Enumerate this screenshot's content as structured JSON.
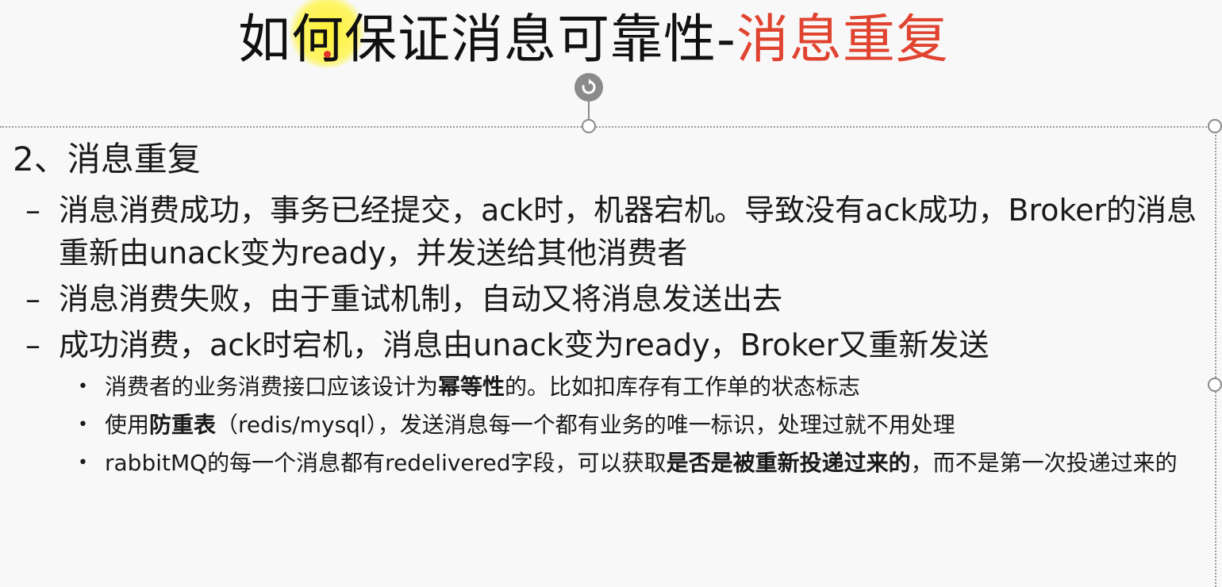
{
  "title": {
    "main": "如何保证消息可靠性-",
    "accent": "消息重复",
    "accent_color": "#e0432f"
  },
  "section_heading": "2、消息重复",
  "bullets": [
    {
      "marker": "–",
      "text": "消息消费成功，事务已经提交，ack时，机器宕机。导致没有ack成功，Broker的消息重新由unack变为ready，并发送给其他消费者"
    },
    {
      "marker": "–",
      "text": "消息消费失败，由于重试机制，自动又将消息发送出去"
    },
    {
      "marker": "–",
      "text": "成功消费，ack时宕机，消息由unack变为ready，Broker又重新发送"
    }
  ],
  "sub_bullets": [
    {
      "marker": "•",
      "pre": "消费者的业务消费接口应该设计为",
      "bold": "幂等性",
      "post": "的。比如扣库存有工作单的状态标志"
    },
    {
      "marker": "•",
      "pre": "使用",
      "bold": "防重表",
      "post": "（redis/mysql），发送消息每一个都有业务的唯一标识，处理过就不用处理"
    },
    {
      "marker": "•",
      "pre": "rabbitMQ的每一个消息都有redelivered字段，可以获取",
      "bold": "是否是被重新投递过来的",
      "post": "，而不是第一次投递过来的"
    }
  ]
}
